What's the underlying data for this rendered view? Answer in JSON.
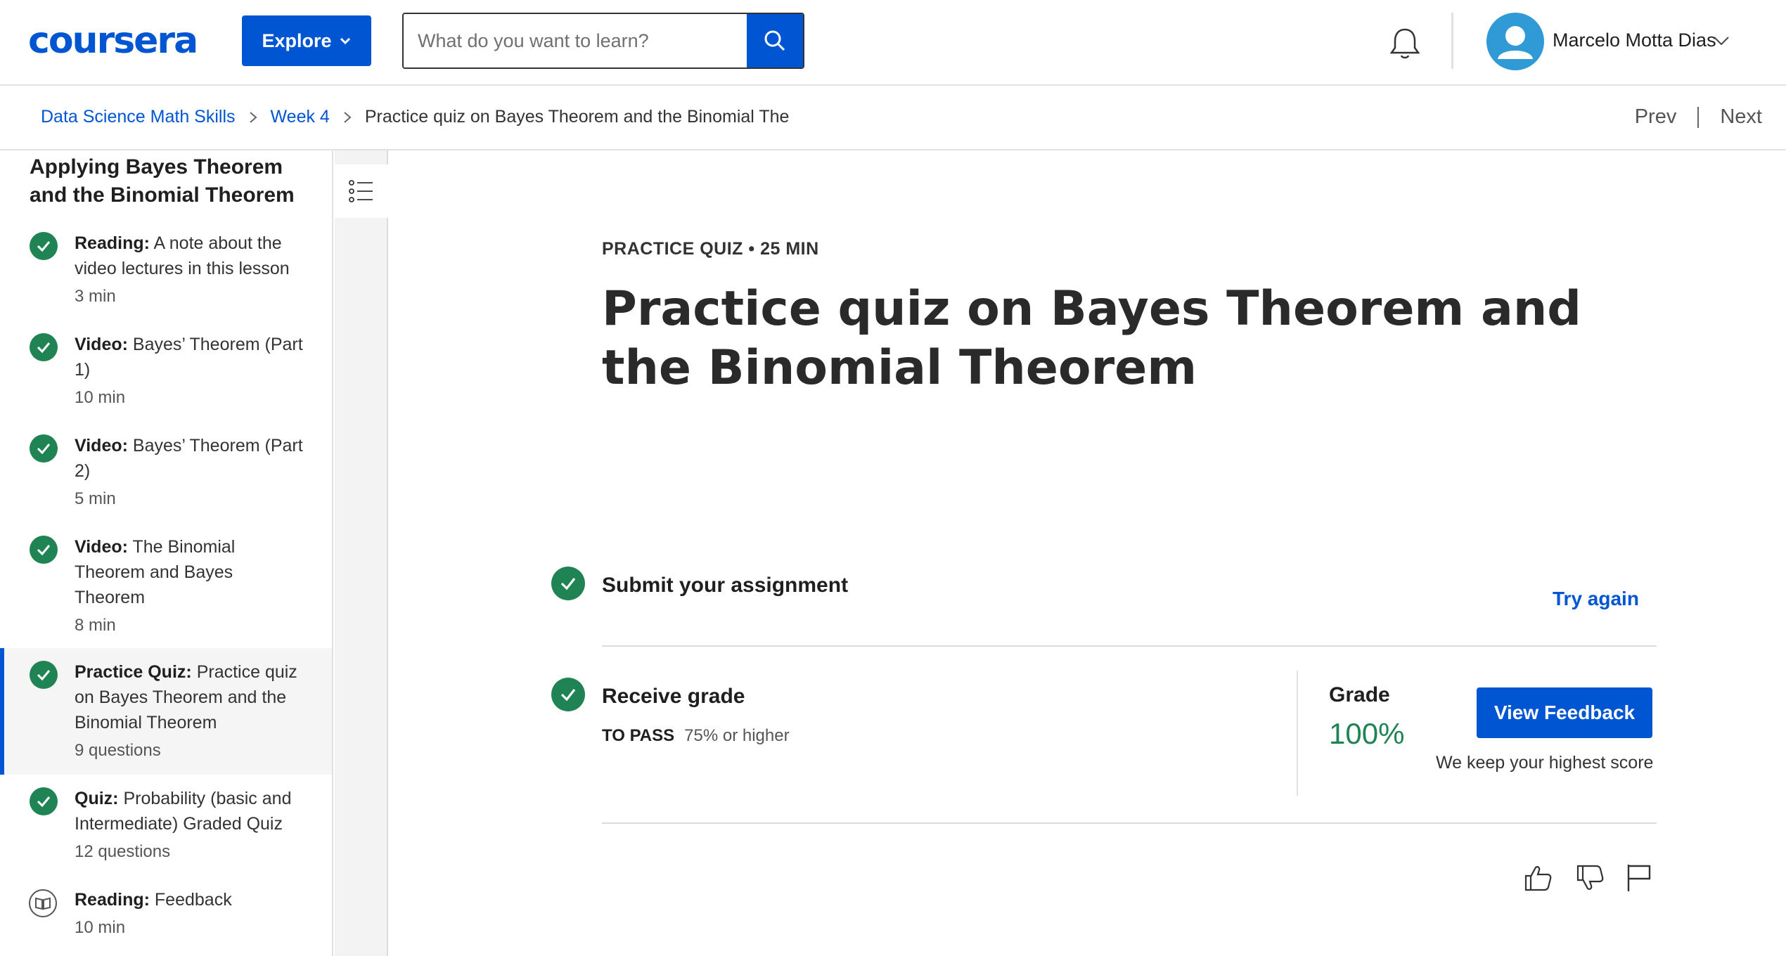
{
  "header": {
    "logo_text": "coursera",
    "explore_label": "Explore",
    "search_placeholder": "What do you want to learn?",
    "user_name": "Marcelo Motta Dias"
  },
  "breadcrumb": {
    "items": [
      "Data Science Math Skills",
      "Week 4"
    ],
    "current": "Practice quiz on Bayes Theorem and the Binomial The",
    "prev_label": "Prev",
    "next_label": "Next"
  },
  "sidebar": {
    "title": "Applying Bayes Theorem and the Binomial Theorem",
    "items": [
      {
        "type": "Reading:",
        "title": "A note about the video lectures in this lesson",
        "meta": "3 min",
        "icon": "check-icon",
        "completed": true
      },
      {
        "type": "Video:",
        "title": "Bayes’ Theorem (Part 1)",
        "meta": "10 min",
        "icon": "check-icon",
        "completed": true
      },
      {
        "type": "Video:",
        "title": "Bayes’ Theorem (Part 2)",
        "meta": "5 min",
        "icon": "check-icon",
        "completed": true
      },
      {
        "type": "Video:",
        "title": "The Binomial Theorem and Bayes Theorem",
        "meta": "8 min",
        "icon": "check-icon",
        "completed": true
      },
      {
        "type": "Practice Quiz:",
        "title": "Practice quiz on Bayes Theorem and the Binomial Theorem",
        "meta": "9 questions",
        "icon": "check-icon",
        "completed": true,
        "active": true
      },
      {
        "type": "Quiz:",
        "title": "Probability (basic and Intermediate) Graded Quiz",
        "meta": "12 questions",
        "icon": "check-icon",
        "completed": true
      },
      {
        "type": "Reading:",
        "title": "Feedback",
        "meta": "10 min",
        "icon": "book-icon",
        "completed": false
      }
    ]
  },
  "main": {
    "kicker": "PRACTICE QUIZ • 25 MIN",
    "title": "Practice quiz on Bayes Theorem and the Binomial Theorem",
    "submit_label": "Submit your assignment",
    "try_again_label": "Try again",
    "receive_grade_label": "Receive grade",
    "to_pass_label": "TO PASS",
    "to_pass_value": "75% or higher",
    "grade_label": "Grade",
    "grade_value": "100%",
    "view_feedback_label": "View Feedback",
    "keep_score_note": "We keep your highest score"
  },
  "colors": {
    "brand_blue": "#0056d2",
    "success_green": "#1f8354",
    "avatar_blue": "#2f9ad6"
  }
}
